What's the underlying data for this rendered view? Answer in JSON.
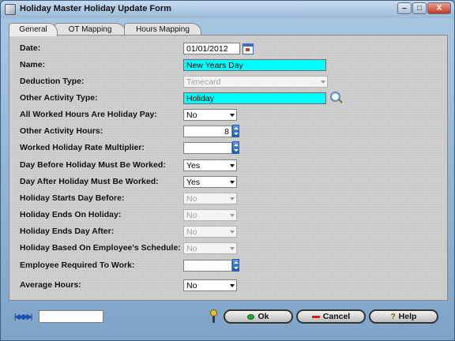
{
  "window": {
    "title": "Holiday Master Holiday Update Form",
    "controls": {
      "minimize": "–",
      "maximize": "□",
      "close": "X"
    }
  },
  "tabs": [
    {
      "label": "General",
      "active": true
    },
    {
      "label": "OT Mapping",
      "active": false
    },
    {
      "label": "Hours Mapping",
      "active": false
    }
  ],
  "form": {
    "date": {
      "label": "Date:",
      "value": "01/01/2012"
    },
    "name": {
      "label": "Name:",
      "value": "New Years Day"
    },
    "deduction_type": {
      "label": "Deduction Type:",
      "value": "Timecard"
    },
    "other_activity_type": {
      "label": "Other Activity Type:",
      "value": "Holiday"
    },
    "all_worked_holiday_pay": {
      "label": "All Worked Hours Are Holiday Pay:",
      "value": "No"
    },
    "other_activity_hours": {
      "label": "Other Activity Hours:",
      "value": "8"
    },
    "worked_holiday_rate_multiplier": {
      "label": "Worked Holiday Rate Multiplier:",
      "value": ""
    },
    "day_before_must_work": {
      "label": "Day Before Holiday Must Be Worked:",
      "value": "Yes"
    },
    "day_after_must_work": {
      "label": "Day After Holiday Must Be Worked:",
      "value": "Yes"
    },
    "starts_day_before": {
      "label": "Holiday Starts Day Before:",
      "value": "No"
    },
    "ends_on_holiday": {
      "label": "Holiday Ends On Holiday:",
      "value": "No"
    },
    "ends_day_after": {
      "label": "Holiday Ends Day After:",
      "value": "No"
    },
    "based_on_schedule": {
      "label": "Holiday Based On Employee's Schedule:",
      "value": "No"
    },
    "employee_required": {
      "label": "Employee Required To Work:",
      "value": ""
    },
    "average_hours": {
      "label": "Average Hours:",
      "value": "No"
    }
  },
  "footer": {
    "ok_label": "Ok",
    "cancel_label": "Cancel",
    "help_label": "Help",
    "nav_glyphs": "|◀◀ ▶▶|"
  },
  "icons": {
    "date": "calendar-icon",
    "lookup": "magnifier-icon",
    "spinner": "spinner-icon",
    "security": "key-icon"
  }
}
